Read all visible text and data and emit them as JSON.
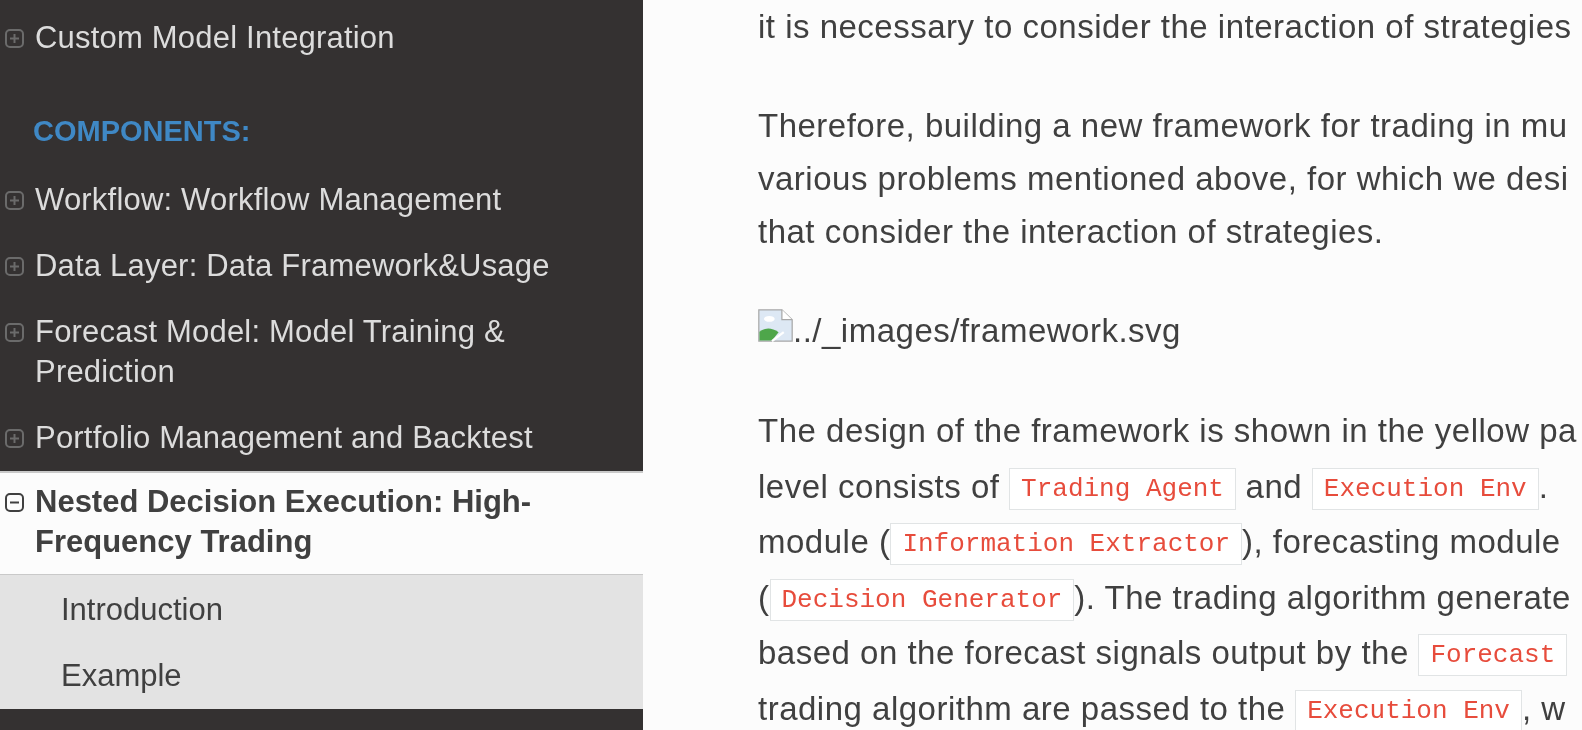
{
  "sidebar": {
    "sections": [
      {
        "items": [
          {
            "label": "Custom Model Integration",
            "expanded": false,
            "selected": false
          }
        ]
      },
      {
        "caption": "COMPONENTS:",
        "items": [
          {
            "label": "Workflow: Workflow Management",
            "expanded": false,
            "selected": false
          },
          {
            "label": "Data Layer: Data Framework&Usage",
            "expanded": false,
            "selected": false
          },
          {
            "label": "Forecast Model: Model Training & Prediction",
            "expanded": false,
            "selected": false
          },
          {
            "label": "Portfolio Management and Backtest",
            "expanded": false,
            "selected": false
          },
          {
            "label": "Nested Decision Execution: High-Frequency Trading",
            "expanded": true,
            "selected": true,
            "children": [
              {
                "label": "Introduction",
                "selected": false
              },
              {
                "label": "Example",
                "selected": false
              }
            ]
          }
        ]
      }
    ]
  },
  "content": {
    "blocks": [
      {
        "kind": "paragraph",
        "lines": [
          [
            {
              "kind": "text",
              "text": "it is necessary to consider the interaction of strategies"
            }
          ]
        ]
      },
      {
        "kind": "paragraph",
        "lines": [
          [
            {
              "kind": "text",
              "text": "Therefore, building a new framework for trading in mu"
            }
          ],
          [
            {
              "kind": "text",
              "text": "various problems mentioned above, for which we desi"
            }
          ],
          [
            {
              "kind": "text",
              "text": "that consider the interaction of strategies."
            }
          ]
        ]
      },
      {
        "kind": "image",
        "alt_text": "../_images/framework.svg"
      },
      {
        "kind": "paragraph",
        "lines": [
          [
            {
              "kind": "text",
              "text": "The design of the framework is shown in the yellow pa"
            }
          ],
          [
            {
              "kind": "text",
              "text": "level consists of "
            },
            {
              "kind": "code",
              "text": "Trading Agent"
            },
            {
              "kind": "text",
              "text": " and "
            },
            {
              "kind": "code",
              "text": "Execution Env"
            },
            {
              "kind": "text",
              "text": "."
            }
          ],
          [
            {
              "kind": "text",
              "text": "module ("
            },
            {
              "kind": "code",
              "text": "Information Extractor"
            },
            {
              "kind": "text",
              "text": "), forecasting module"
            }
          ],
          [
            {
              "kind": "text",
              "text": "("
            },
            {
              "kind": "code",
              "text": "Decision Generator"
            },
            {
              "kind": "text",
              "text": "). The trading algorithm generate"
            }
          ],
          [
            {
              "kind": "text",
              "text": "based on the forecast signals output by the "
            },
            {
              "kind": "code",
              "text": "Forecast"
            }
          ],
          [
            {
              "kind": "text",
              "text": "trading algorithm are passed to the "
            },
            {
              "kind": "code",
              "text": "Execution Env"
            },
            {
              "kind": "text",
              "text": ", w"
            }
          ]
        ]
      }
    ]
  }
}
